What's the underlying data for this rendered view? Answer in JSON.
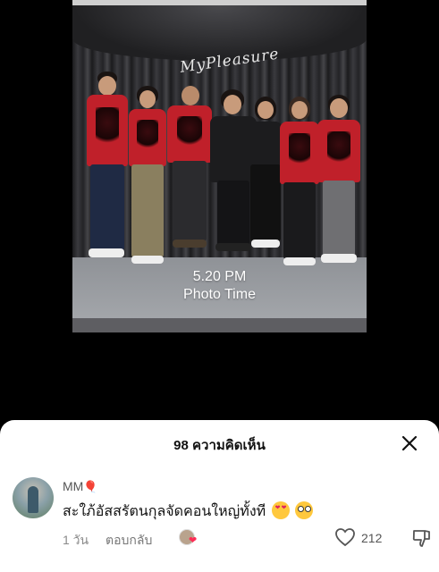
{
  "post": {
    "stage_logo_text": "MyPleasure",
    "caption_line1": "5.20 PM",
    "caption_line2": "Photo Time"
  },
  "comments_sheet": {
    "title": "98 ความคิดเห็น",
    "close_icon": "close-icon"
  },
  "comment": {
    "username": "MM",
    "username_emoji": "🎈",
    "text": "สะใภ้อัสสรัตนกุลจัดคอนใหญ่ทั้งที",
    "emojis": [
      "heart-eyes-emoji",
      "flushed-emoji"
    ],
    "time": "1 วัน",
    "reply_label": "ตอบกลับ",
    "like_count": "212",
    "icons": {
      "like": "heart-outline-icon",
      "dislike": "thumbs-down-icon",
      "creator_liked": "creator-liked-icon"
    }
  },
  "colors": {
    "background": "#000000",
    "sheet": "#ffffff",
    "shirt_red": "#c0202a",
    "like_pink": "#fe2c55"
  }
}
